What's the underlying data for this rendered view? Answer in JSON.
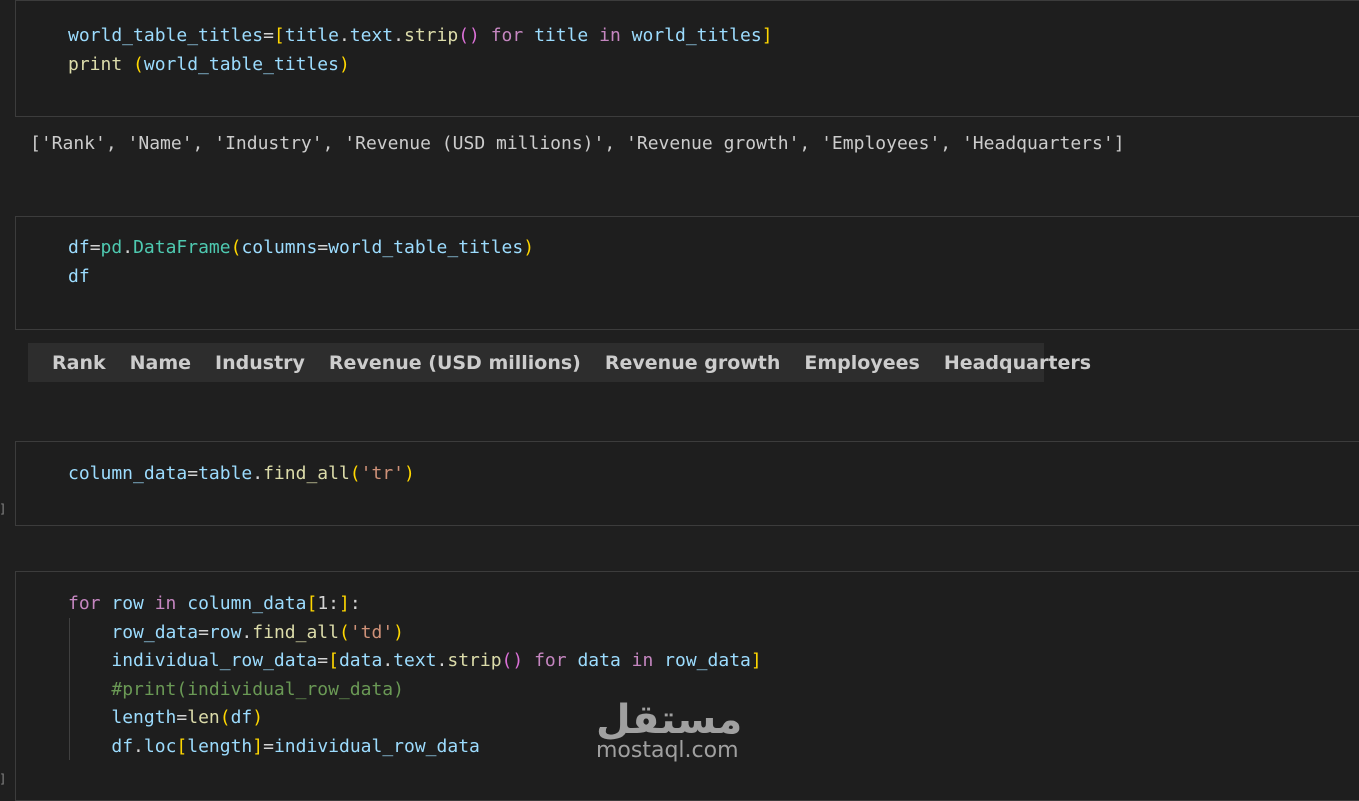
{
  "cells": [
    {
      "lines": [
        [
          [
            "v",
            "world_table_titles"
          ],
          [
            "op",
            "="
          ],
          [
            "b1",
            "["
          ],
          [
            "v",
            "title"
          ],
          [
            "op",
            "."
          ],
          [
            "v",
            "text"
          ],
          [
            "op",
            "."
          ],
          [
            "f",
            "strip"
          ],
          [
            "b2",
            "()"
          ],
          [
            "op",
            " "
          ],
          [
            "k",
            "for"
          ],
          [
            "op",
            " "
          ],
          [
            "v",
            "title"
          ],
          [
            "op",
            " "
          ],
          [
            "k",
            "in"
          ],
          [
            "op",
            " "
          ],
          [
            "v",
            "world_titles"
          ],
          [
            "b1",
            "]"
          ]
        ],
        [
          [
            "f",
            "print"
          ],
          [
            "op",
            " "
          ],
          [
            "b1",
            "("
          ],
          [
            "v",
            "world_table_titles"
          ],
          [
            "b1",
            ")"
          ]
        ]
      ]
    },
    {
      "lines": [
        [
          [
            "v",
            "df"
          ],
          [
            "op",
            "="
          ],
          [
            "cl",
            "pd"
          ],
          [
            "op",
            "."
          ],
          [
            "cl",
            "DataFrame"
          ],
          [
            "b1",
            "("
          ],
          [
            "v",
            "columns"
          ],
          [
            "op",
            "="
          ],
          [
            "v",
            "world_table_titles"
          ],
          [
            "b1",
            ")"
          ]
        ],
        [
          [
            "v",
            "df"
          ]
        ]
      ]
    },
    {
      "lines": [
        [
          [
            "v",
            "column_data"
          ],
          [
            "op",
            "="
          ],
          [
            "v",
            "table"
          ],
          [
            "op",
            "."
          ],
          [
            "f",
            "find_all"
          ],
          [
            "b1",
            "("
          ],
          [
            "s",
            "'tr'"
          ],
          [
            "b1",
            ")"
          ]
        ]
      ]
    },
    {
      "lines": [
        [
          [
            "k",
            "for"
          ],
          [
            "op",
            " "
          ],
          [
            "v",
            "row"
          ],
          [
            "op",
            " "
          ],
          [
            "k",
            "in"
          ],
          [
            "op",
            " "
          ],
          [
            "v",
            "column_data"
          ],
          [
            "b1",
            "["
          ],
          [
            "op",
            "1:"
          ],
          [
            "b1",
            "]"
          ],
          [
            "op",
            ":"
          ]
        ],
        [
          [
            "op",
            "    "
          ],
          [
            "v",
            "row_data"
          ],
          [
            "op",
            "="
          ],
          [
            "v",
            "row"
          ],
          [
            "op",
            "."
          ],
          [
            "f",
            "find_all"
          ],
          [
            "b1",
            "("
          ],
          [
            "s",
            "'td'"
          ],
          [
            "b1",
            ")"
          ]
        ],
        [
          [
            "op",
            "    "
          ],
          [
            "v",
            "individual_row_data"
          ],
          [
            "op",
            "="
          ],
          [
            "b1",
            "["
          ],
          [
            "v",
            "data"
          ],
          [
            "op",
            "."
          ],
          [
            "v",
            "text"
          ],
          [
            "op",
            "."
          ],
          [
            "f",
            "strip"
          ],
          [
            "b2",
            "()"
          ],
          [
            "op",
            " "
          ],
          [
            "k",
            "for"
          ],
          [
            "op",
            " "
          ],
          [
            "v",
            "data"
          ],
          [
            "op",
            " "
          ],
          [
            "k",
            "in"
          ],
          [
            "op",
            " "
          ],
          [
            "v",
            "row_data"
          ],
          [
            "b1",
            "]"
          ]
        ],
        [
          [
            "op",
            "    "
          ],
          [
            "c",
            "#print(individual_row_data)"
          ]
        ],
        [
          [
            "op",
            "    "
          ],
          [
            "v",
            "length"
          ],
          [
            "op",
            "="
          ],
          [
            "f",
            "len"
          ],
          [
            "b1",
            "("
          ],
          [
            "v",
            "df"
          ],
          [
            "b1",
            ")"
          ]
        ],
        [
          [
            "op",
            "    "
          ],
          [
            "v",
            "df"
          ],
          [
            "op",
            "."
          ],
          [
            "v",
            "loc"
          ],
          [
            "b1",
            "["
          ],
          [
            "v",
            "length"
          ],
          [
            "b1",
            "]"
          ],
          [
            "op",
            "="
          ],
          [
            "v",
            "individual_row_data"
          ]
        ]
      ]
    }
  ],
  "output_list": "['Rank', 'Name', 'Industry', 'Revenue (USD millions)', 'Revenue growth', 'Employees', 'Headquarters']",
  "dataframe_columns": [
    "Rank",
    "Name",
    "Industry",
    "Revenue (USD millions)",
    "Revenue growth",
    "Employees",
    "Headquarters"
  ],
  "edge_marks": [
    "]",
    "]"
  ],
  "watermark": {
    "arabic": "مستقل",
    "latin": "mostaql.com"
  }
}
